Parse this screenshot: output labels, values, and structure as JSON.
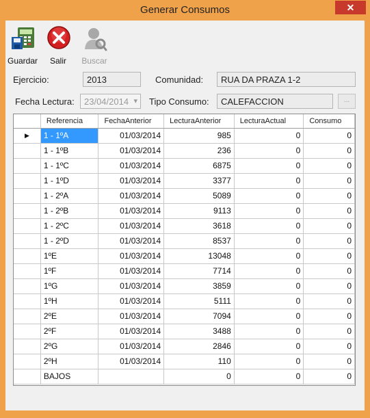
{
  "window": {
    "title": "Generar Consumos",
    "close": "✕"
  },
  "toolbar": {
    "guardar": "Guardar",
    "salir": "Salir",
    "buscar": "Buscar"
  },
  "form": {
    "ejercicio_label": "Ejercicio:",
    "ejercicio_value": "2013",
    "comunidad_label": "Comunidad:",
    "comunidad_value": "RUA DA PRAZA 1-2",
    "fecha_label": "Fecha Lectura:",
    "fecha_value": "23/04/2014",
    "tipo_label": "Tipo Consumo:",
    "tipo_value": "CALEFACCION",
    "browse": "..."
  },
  "grid": {
    "columns": [
      "Referencia",
      "FechaAnterior",
      "LecturaAnterior",
      "LecturaActual",
      "Consumo"
    ],
    "current_row_marker": "▶",
    "rows": [
      [
        "1 - 1ºA",
        "01/03/2014",
        "985",
        "0",
        "0"
      ],
      [
        "1 - 1ºB",
        "01/03/2014",
        "236",
        "0",
        "0"
      ],
      [
        "1 - 1ºC",
        "01/03/2014",
        "6875",
        "0",
        "0"
      ],
      [
        "1 - 1ºD",
        "01/03/2014",
        "3377",
        "0",
        "0"
      ],
      [
        "1 - 2ºA",
        "01/03/2014",
        "5089",
        "0",
        "0"
      ],
      [
        "1 - 2ºB",
        "01/03/2014",
        "9113",
        "0",
        "0"
      ],
      [
        "1 - 2ºC",
        "01/03/2014",
        "3618",
        "0",
        "0"
      ],
      [
        "1 - 2ºD",
        "01/03/2014",
        "8537",
        "0",
        "0"
      ],
      [
        "1ºE",
        "01/03/2014",
        "13048",
        "0",
        "0"
      ],
      [
        "1ºF",
        "01/03/2014",
        "7714",
        "0",
        "0"
      ],
      [
        "1ºG",
        "01/03/2014",
        "3859",
        "0",
        "0"
      ],
      [
        "1ºH",
        "01/03/2014",
        "5111",
        "0",
        "0"
      ],
      [
        "2ºE",
        "01/03/2014",
        "7094",
        "0",
        "0"
      ],
      [
        "2ºF",
        "01/03/2014",
        "3488",
        "0",
        "0"
      ],
      [
        "2ºG",
        "01/03/2014",
        "2846",
        "0",
        "0"
      ],
      [
        "2ºH",
        "01/03/2014",
        "110",
        "0",
        "0"
      ],
      [
        "BAJOS",
        "",
        "0",
        "0",
        "0"
      ]
    ]
  },
  "colors": {
    "titlebar": "#f0a24a",
    "selection": "#3399ff",
    "close": "#c7392b"
  }
}
